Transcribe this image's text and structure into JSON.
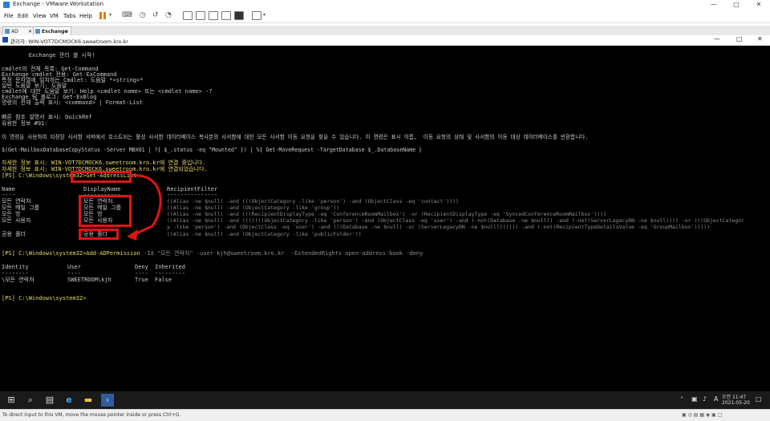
{
  "window": {
    "title": "Exchange - VMware Workstation"
  },
  "menu": [
    "File",
    "Edit",
    "View",
    "VM",
    "Tabs",
    "Help"
  ],
  "tabs": [
    {
      "label": "AD"
    },
    {
      "label": "Exchange"
    }
  ],
  "guest_title": "관리자: WIN-VOT7DCMOCK6.sweetroom.kro.kr",
  "console": {
    "banner": "        Exchange 관리 셸 시작!",
    "lines": [
      "cmdlet의 전체 목록: Get-Command",
      "Exchange cmdlet 전용: Get-ExCommand",
      "특정 문자열에 일치하는 Cmdlet: 도움말 *<string>*",
      "일반 도움말 보기: 도움말",
      "cmdlet에 대한 도움말 보기: Help <cmdlet name> 또는 <cmdlet name> -?",
      "Exchange 팀 블로그: Get-ExBlog",
      "명령의 전체 출력 표시: <command> | Format-List"
    ],
    "tip_lines": [
      "빠른 참조 설명서 표시: QuickRef",
      "유용한 정보 #91:"
    ],
    "tip_text": "이 명령을 사용하여 지정된 사서함 서버에서 호스트되는 활성 사서함 데이터베이스 복사본의 사서함에 대한 모든 사서함 이동 요청을 찾을 수 있습니다. 이 명령은 표시 이름,  이동 요청의 상태 및 사서함의 이동 대상 데이터베이스를 반환합니다.",
    "tip_cmd": "$(Get-MailboxDatabaseCopyStatus -Server MBX01 | ?{ $_.status -eq \"Mounted\" }) | %{ Get-MoveRequest -TargetDatabase $_.DatabaseName }",
    "connect1": "자세한 정보 표시: WIN-VOT7DCMOCK6.sweetroom.kro.kr에 연결 중입니다.",
    "connect2": "자세한 정보 표시: WIN-VOT7DCMOCK6.sweetroom.kro.kr에 연결되었습니다.",
    "prompt1": "[PS] C:\\Windows\\system32>",
    "cmd1": "Get-AddressList",
    "table1": {
      "headers": [
        "Name",
        "DisplayName",
        "RecipientFilter"
      ],
      "rows": [
        [
          "모든 연락처",
          "모든 연락처",
          "((Alias -ne $null) -and (((ObjectCategory -like 'person') -and (ObjectClass -eq 'contact'))))"
        ],
        [
          "모든 메일 그룹",
          "모든 메일 그룹",
          "((Alias -ne $null) -and (ObjectCategory -like 'group'))"
        ],
        [
          "모든 방",
          "모든 방",
          "((Alias -ne $null) -and (((RecipientDisplayType -eq 'ConferenceRoomMailbox') -or (RecipientDisplayType -eq 'SyncedConferenceRoomMailbox'))))"
        ],
        [
          "모든 사용자",
          "모든 사용자",
          "((Alias -ne $null) -and (((((((ObjectCategory -like 'person') -and (ObjectClass -eq 'user') -and (-not(Database -ne $null)) -and (-not(ServerLegacyDN -ne $null)))) -or (((ObjectCategor"
        ],
        [
          "",
          "",
          "y -like 'person') -and (ObjectClass -eq 'user') -and (((Database -ne $null) -or (ServerLegacyDN -ne $null))))))) -and (-not(RecipientTypeDetailsValue -eq 'GroupMailbox')))))"
        ],
        [
          "공용 폴더",
          "공용 폴더",
          "((Alias -ne $null) -and (ObjectCategory -like 'publicFolder'))"
        ]
      ]
    },
    "prompt2": "[PS] C:\\Windows\\system32>",
    "cmd2": "Add-ADPermission",
    "cmd2_args": " -Id \"모든 연락처\" -user kjh@sweetroom.kro.kr  -ExtendedRights open-address-book -deny",
    "table2": {
      "headers": [
        "Identity",
        "User",
        "Deny",
        "Inherited"
      ],
      "row": [
        "\\모든 연락처",
        "SWEETROOM\\kjh",
        "True",
        "False"
      ]
    },
    "prompt3": "[PS] C:\\Windows\\system32>"
  },
  "taskbar": {
    "ime": "A",
    "time": "오전 11:47",
    "date": "2021-05-20"
  },
  "status": {
    "text": "To direct input to this VM, move the mouse pointer inside or press Ctrl+G."
  },
  "colors": {
    "console_bg": "#000000",
    "highlight": "#e01414",
    "prompt": "#e6d96a"
  }
}
